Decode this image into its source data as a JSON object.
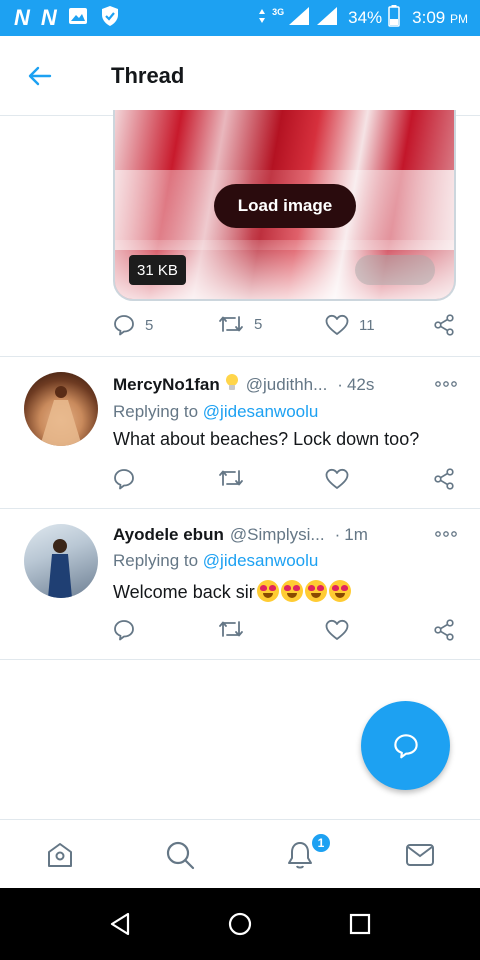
{
  "status_bar": {
    "net_type": "3G",
    "battery": "34%",
    "time": "3:09",
    "ampm": "PM"
  },
  "header": {
    "title": "Thread"
  },
  "media": {
    "load_label": "Load image",
    "size": "31 KB"
  },
  "main_tweet_actions": {
    "replies": "5",
    "retweets": "5",
    "likes": "11"
  },
  "tweets": [
    {
      "name": "MercyNo1fan",
      "handle": "@judithh...",
      "separator": "·",
      "time": "42s",
      "reply_prefix": "Replying to",
      "reply_to": "@jidesanwoolu",
      "text": "What about beaches? Lock down too?"
    },
    {
      "name": "Ayodele ebun",
      "handle": "@Simplysi...",
      "separator": "·",
      "time": "1m",
      "reply_prefix": "Replying to",
      "reply_to": "@jidesanwoolu",
      "text": "Welcome back sir"
    }
  ],
  "bottom_nav": {
    "notification_count": "1"
  },
  "colors": {
    "accent": "#1da1f2",
    "muted": "#657786",
    "divider": "#e1e8ed"
  },
  "icons": [
    "back-arrow-icon",
    "reply-icon",
    "retweet-icon",
    "like-icon",
    "share-icon",
    "more-icon",
    "compose-icon",
    "home-icon",
    "search-icon",
    "notifications-icon",
    "messages-icon"
  ]
}
